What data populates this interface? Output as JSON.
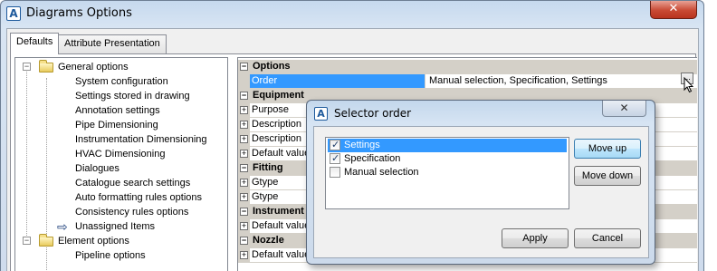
{
  "window": {
    "title": "Diagrams Options",
    "close_label": "✕"
  },
  "tabs": [
    {
      "label": "Defaults",
      "active": true
    },
    {
      "label": "Attribute Presentation",
      "active": false
    }
  ],
  "tree": {
    "general_options": "General options",
    "general_children": [
      "System configuration",
      "Settings stored in drawing",
      "Annotation settings",
      "Pipe Dimensioning",
      "Instrumentation Dimensioning",
      "HVAC Dimensioning",
      "Dialogues",
      "Catalogue search settings",
      "Auto formatting rules options",
      "Consistency rules options",
      "Unassigned Items"
    ],
    "element_options": "Element options",
    "element_children": [
      "Pipeline options"
    ]
  },
  "grid": {
    "rows": [
      {
        "kind": "cat",
        "label": "Options"
      },
      {
        "kind": "prop",
        "label": "Order",
        "value": "Manual selection, Specification, Settings",
        "selected": true
      },
      {
        "kind": "cat",
        "label": "Equipment"
      },
      {
        "kind": "prop",
        "label": "Purpose",
        "value": ""
      },
      {
        "kind": "prop",
        "label": "Description",
        "value": ""
      },
      {
        "kind": "prop",
        "label": "Description",
        "value": ""
      },
      {
        "kind": "prop",
        "label": "Default value",
        "value": ""
      },
      {
        "kind": "cat",
        "label": "Fitting"
      },
      {
        "kind": "prop",
        "label": "Gtype",
        "value": ""
      },
      {
        "kind": "prop",
        "label": "Gtype",
        "value": ""
      },
      {
        "kind": "cat",
        "label": "Instrument"
      },
      {
        "kind": "prop",
        "label": "Default value",
        "value": ""
      },
      {
        "kind": "cat",
        "label": "Nozzle"
      },
      {
        "kind": "prop",
        "label": "Default value",
        "value": ""
      }
    ],
    "ellipsis_label": "..."
  },
  "dialog": {
    "title": "Selector order",
    "close_label": "✕",
    "items": [
      {
        "label": "Settings",
        "checked": true,
        "selected": true
      },
      {
        "label": "Specification",
        "checked": true,
        "selected": false
      },
      {
        "label": "Manual selection",
        "checked": false,
        "selected": false
      }
    ],
    "move_up": "Move up",
    "move_down": "Move down",
    "apply": "Apply",
    "cancel": "Cancel"
  }
}
